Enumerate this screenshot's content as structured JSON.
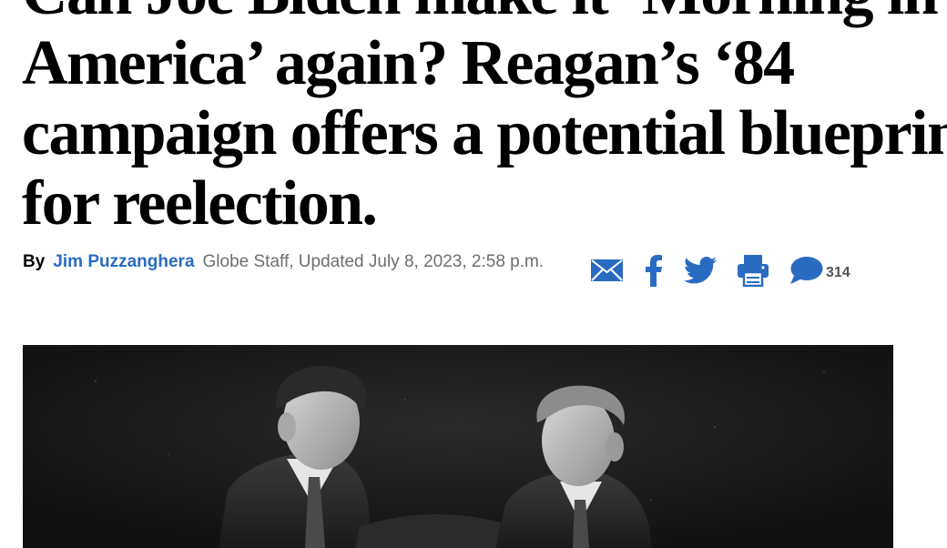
{
  "article": {
    "headline_lines": [
      "Can Joe Biden make it ‘Morning in",
      "America’ again? Reagan’s ‘84",
      "campaign offers a potential blueprint",
      "for reelection."
    ],
    "byline": {
      "by": "By",
      "author": "Jim Puzzanghera",
      "meta": "Globe Staff, Updated July 8, 2023, 2:58 p.m."
    },
    "share": {
      "icons": [
        "email-icon",
        "facebook-icon",
        "twitter-icon",
        "print-icon",
        "comment-icon"
      ],
      "comment_count": "314",
      "accent_color": "#2a6bc2"
    },
    "photo": {
      "description_icon": "black-and-white photo"
    }
  }
}
